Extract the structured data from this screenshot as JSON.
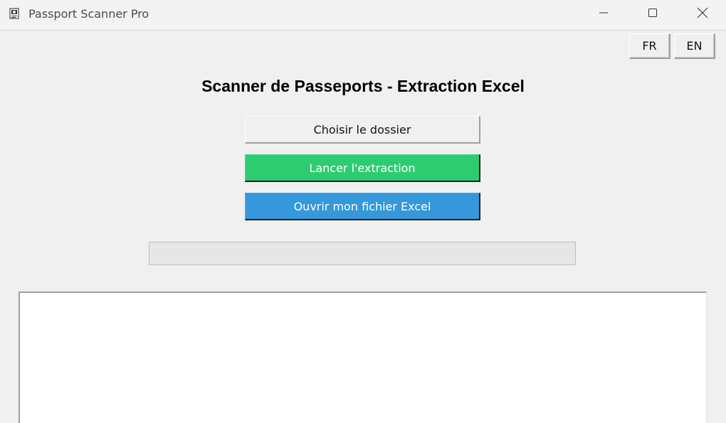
{
  "window": {
    "title": "Passport Scanner Pro",
    "app_icon": "passport-scanner-icon",
    "controls": {
      "minimize_icon": "minimize-icon",
      "maximize_icon": "maximize-icon",
      "close_icon": "close-icon"
    }
  },
  "language": {
    "fr_label": "FR",
    "en_label": "EN"
  },
  "main": {
    "heading": "Scanner de Passeports - Extraction Excel",
    "choose_folder_label": "Choisir le dossier",
    "start_extraction_label": "Lancer l'extraction",
    "open_excel_label": "Ouvrir mon fichier Excel",
    "progress_fraction": 0,
    "log_text": ""
  },
  "colors": {
    "start_button": "#2ecc71",
    "open_button": "#3498db",
    "progress_fill": "#06b025"
  }
}
